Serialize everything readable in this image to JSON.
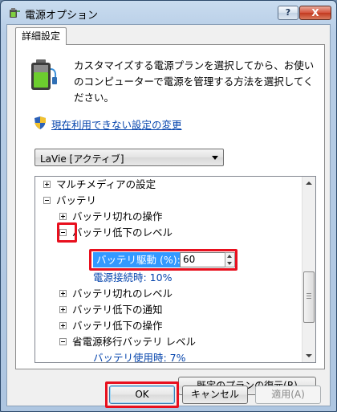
{
  "window": {
    "title": "電源オプション",
    "help_button": "?",
    "close_button": "X"
  },
  "tab": {
    "label": "詳細設定"
  },
  "description": "カスタマイズする電源プランを選択してから、お使いのコンピューターで電源を管理する方法を選択してください。",
  "link": {
    "label": "現在利用できない設定の変更"
  },
  "plan_select": {
    "value": "LaVie [アクティブ]"
  },
  "tree": {
    "items": [
      {
        "label": "マルチメディアの設定",
        "state": "collapsed"
      },
      {
        "label": "バッテリ",
        "state": "expanded"
      },
      {
        "label": "バッテリ切れの操作",
        "state": "collapsed"
      },
      {
        "label": "バッテリ低下のレベル",
        "state": "expanded"
      },
      {
        "label": "バッテリ切れのレベル",
        "state": "collapsed"
      },
      {
        "label": "バッテリ低下の通知",
        "state": "collapsed"
      },
      {
        "label": "バッテリ低下の操作",
        "state": "collapsed"
      },
      {
        "label": "省電源移行バッテリ レベル",
        "state": "expanded"
      }
    ],
    "spin": {
      "label": "バッテリ駆動 (%):",
      "value": "60"
    },
    "plugged_in": "電源接続時: 10%",
    "cut_off_child": "バッテリ使用時: 7%"
  },
  "buttons": {
    "restore": "既定のプランの復元(R)",
    "ok": "OK",
    "cancel": "キャンセル",
    "apply": "適用(A)"
  },
  "colors": {
    "highlight_box": "#e8101e",
    "selection": "#3399ff",
    "link": "#0645ad"
  }
}
